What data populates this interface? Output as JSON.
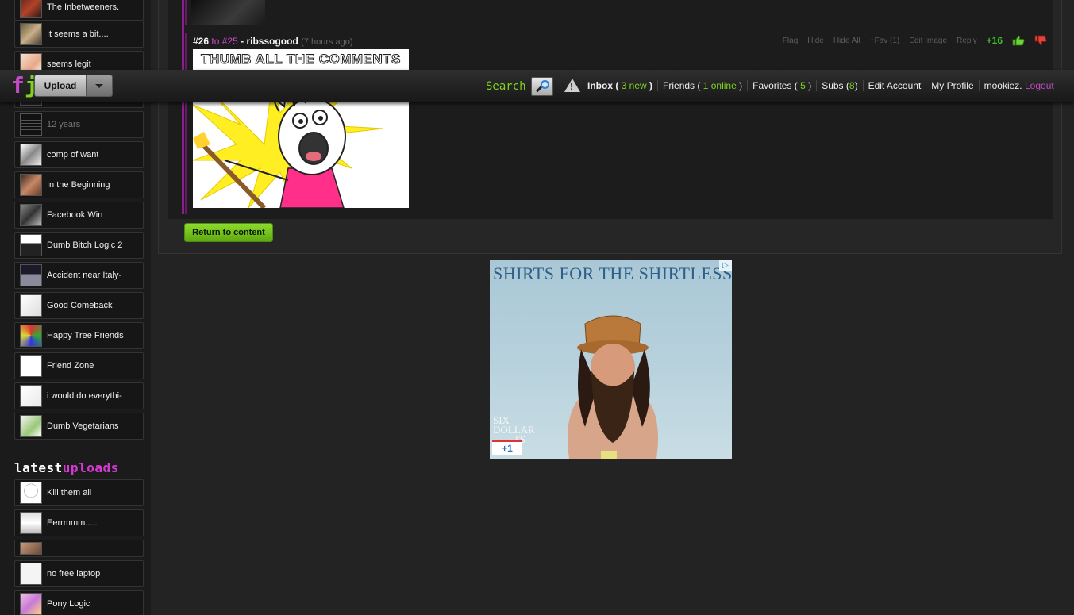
{
  "sidebar": {
    "top_items": [
      {
        "label": "The Inbetweeners.",
        "dim": false
      },
      {
        "label": "It seems a bit....",
        "dim": false
      },
      {
        "label": "seems legit",
        "dim": false
      },
      {
        "label": "",
        "dim": false
      },
      {
        "label": "12 years",
        "dim": true
      },
      {
        "label": "comp of want",
        "dim": false
      },
      {
        "label": "In the Beginning",
        "dim": false
      },
      {
        "label": "Facebook Win",
        "dim": false
      },
      {
        "label": "Dumb Bitch Logic 2",
        "dim": false
      },
      {
        "label": "Accident near Italy-",
        "dim": false
      },
      {
        "label": "Good Comeback",
        "dim": false
      },
      {
        "label": "Happy Tree Friends",
        "dim": false
      },
      {
        "label": "Friend Zone",
        "dim": false
      },
      {
        "label": "i would do everythi-",
        "dim": false
      },
      {
        "label": "Dumb Vegetarians",
        "dim": false
      }
    ],
    "latest_heading_1": "latest",
    "latest_heading_2": "uploads",
    "latest_items": [
      {
        "label": "Kill them all"
      },
      {
        "label": "Eerrmmm....."
      },
      {
        "label": ""
      },
      {
        "label": "no free laptop"
      },
      {
        "label": "Pony Logic"
      }
    ]
  },
  "topbar": {
    "logo_f": "f",
    "logo_j": "j",
    "upload_label": "Upload",
    "search_label": "Search",
    "inbox_label": "Inbox (",
    "inbox_count": "3 new",
    "inbox_close": ")",
    "friends_label": "Friends (",
    "friends_count": "1 online",
    "friends_close": ")",
    "favorites_label": "Favorites (",
    "favorites_count": "5",
    "favorites_close": ")",
    "subs_label": "Subs (",
    "subs_count": "8",
    "subs_close": ")",
    "edit_account": "Edit Account",
    "my_profile": "My Profile",
    "username": "mookiez.",
    "logout": "Logout"
  },
  "comment": {
    "number": "#26",
    "to_text": "to",
    "reply_to": "#25",
    "dash": "-",
    "author": "ribssogood",
    "time": "(7 hours ago)",
    "actions": [
      "Flag",
      "Hide",
      "Hide All",
      "+Fav (1)",
      "Edit Image",
      "Reply"
    ],
    "score": "+16",
    "meme_caption": "THUMB ALL THE COMMENTS"
  },
  "return_button": "Return to content",
  "ad": {
    "title": "SHIRTS FOR THE SHIRTLESS",
    "badge": "▷",
    "sub_line1": "SIX",
    "sub_line2": "DOLLAR",
    "sub_line3": "TS",
    "plus_one": "+1"
  },
  "colors": {
    "accent_green": "#7fd21e",
    "accent_purple": "#c34bc3",
    "score_green": "#3fbf2a",
    "background": "#232323"
  }
}
